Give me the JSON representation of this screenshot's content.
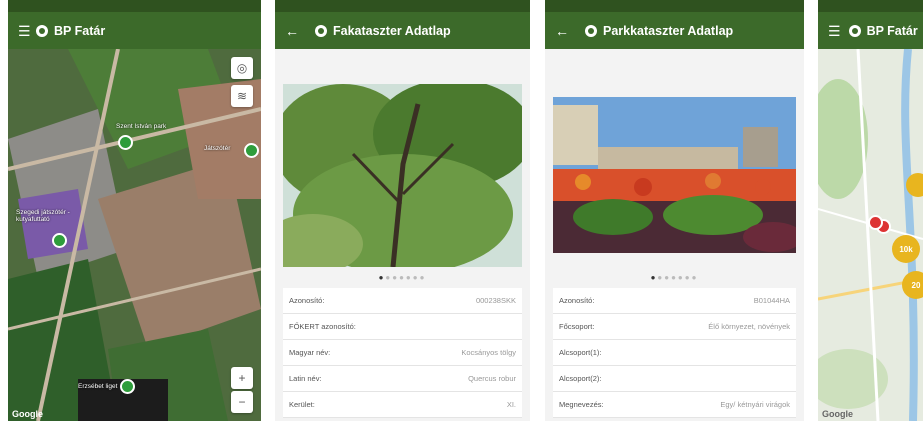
{
  "screen1": {
    "title": "BP Fatár",
    "labels": [
      "Szent István park",
      "Játszótér",
      "Szegedi játszótér - kutyafuttató",
      "Erzsébet liget"
    ],
    "google": "Google",
    "zoom_in": "+",
    "zoom_out": "−"
  },
  "screen2": {
    "title": "Fakataszter Adatlap",
    "rows": [
      {
        "label": "Azonosító:",
        "value": "000238SKK"
      },
      {
        "label": "FŐKERT azonosító:",
        "value": ""
      },
      {
        "label": "Magyar név:",
        "value": "Kocsányos tölgy"
      },
      {
        "label": "Latin név:",
        "value": "Quercus robur"
      },
      {
        "label": "Kerület:",
        "value": "XI."
      }
    ]
  },
  "screen3": {
    "title": "Parkkataszter Adatlap",
    "rows": [
      {
        "label": "Azonosító:",
        "value": "B01044HA"
      },
      {
        "label": "Főcsoport:",
        "value": "Élő környezet, növények"
      },
      {
        "label": "Alcsoport(1):",
        "value": ""
      },
      {
        "label": "Alcsoport(2):",
        "value": ""
      },
      {
        "label": "Megnevezés:",
        "value": "Egy/ kétnyári virágok"
      }
    ]
  },
  "screen4": {
    "title": "BP Fatár",
    "clusters": [
      "10k",
      "20"
    ],
    "google": "Google"
  },
  "colors": {
    "appbar": "#3c6a2a",
    "statusbar": "#2f521f"
  }
}
